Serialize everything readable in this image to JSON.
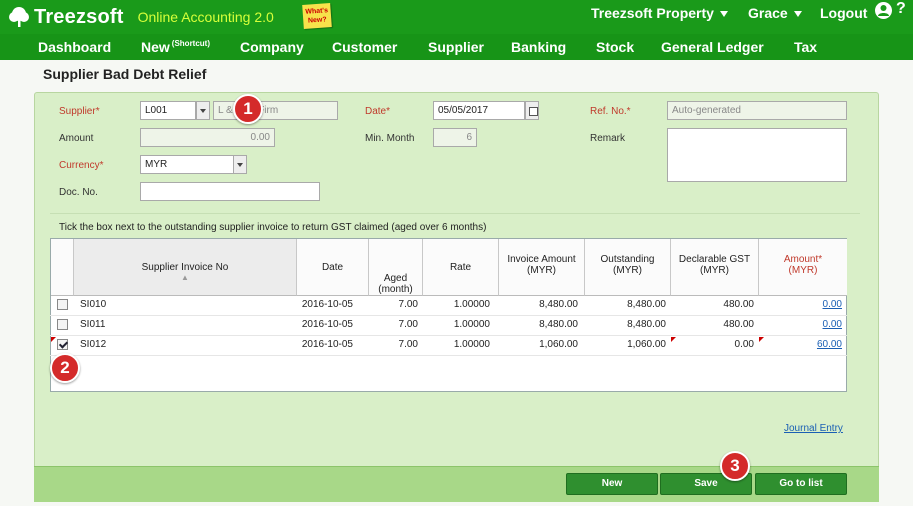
{
  "header": {
    "brand": "Treezsoft",
    "tagline": "Online Accounting 2.0",
    "whats_new": "What's New?",
    "company_menu": "Treezsoft Property",
    "user_menu": "Grace",
    "logout": "Logout",
    "help": "?"
  },
  "nav": {
    "dashboard": "Dashboard",
    "new": "New",
    "new_sup": "(Shortcut)",
    "company": "Company",
    "customer": "Customer",
    "supplier": "Supplier",
    "banking": "Banking",
    "stock": "Stock",
    "general_ledger": "General Ledger",
    "tax": "Tax"
  },
  "page": {
    "title": "Supplier Bad Debt Relief"
  },
  "form": {
    "supplier_label": "Supplier*",
    "supplier_code": "L001",
    "supplier_name": "L & ... er Firm",
    "amount_label": "Amount",
    "amount_value": "0.00",
    "currency_label": "Currency*",
    "currency_value": "MYR",
    "docno_label": "Doc. No.",
    "docno_value": "",
    "date_label": "Date*",
    "date_value": "05/05/2017",
    "minmonth_label": "Min. Month",
    "minmonth_value": "6",
    "refno_label": "Ref. No.*",
    "refno_value": "Auto-generated",
    "remark_label": "Remark",
    "remark_value": ""
  },
  "hint": "Tick the box next to the outstanding supplier invoice to return GST claimed (aged over 6 months)",
  "table": {
    "headers": {
      "invoice_no": "Supplier Invoice No",
      "date": "Date",
      "aged_1": "Aged",
      "aged_2": "(month)",
      "rate": "Rate",
      "inv_amount_1": "Invoice Amount",
      "inv_amount_2": "(MYR)",
      "outstanding_1": "Outstanding",
      "outstanding_2": "(MYR)",
      "declarable_1": "Declarable GST",
      "declarable_2": "(MYR)",
      "amount_1": "Amount*",
      "amount_2": "(MYR)"
    },
    "rows": [
      {
        "checked": false,
        "invoice_no": "SI010",
        "date": "2016-10-05",
        "aged": "7.00",
        "rate": "1.00000",
        "inv_amount": "8,480.00",
        "outstanding": "8,480.00",
        "declarable": "480.00",
        "amount": "0.00"
      },
      {
        "checked": false,
        "invoice_no": "SI011",
        "date": "2016-10-05",
        "aged": "7.00",
        "rate": "1.00000",
        "inv_amount": "8,480.00",
        "outstanding": "8,480.00",
        "declarable": "480.00",
        "amount": "0.00"
      },
      {
        "checked": true,
        "invoice_no": "SI012",
        "date": "2016-10-05",
        "aged": "7.00",
        "rate": "1.00000",
        "inv_amount": "1,060.00",
        "outstanding": "1,060.00",
        "declarable": "0.00",
        "amount": "60.00"
      }
    ]
  },
  "links": {
    "journal_entry": "Journal Entry"
  },
  "buttons": {
    "new": "New",
    "save": "Save",
    "go_to_list": "Go to list"
  },
  "badges": {
    "b1": "1",
    "b2": "2",
    "b3": "3"
  }
}
